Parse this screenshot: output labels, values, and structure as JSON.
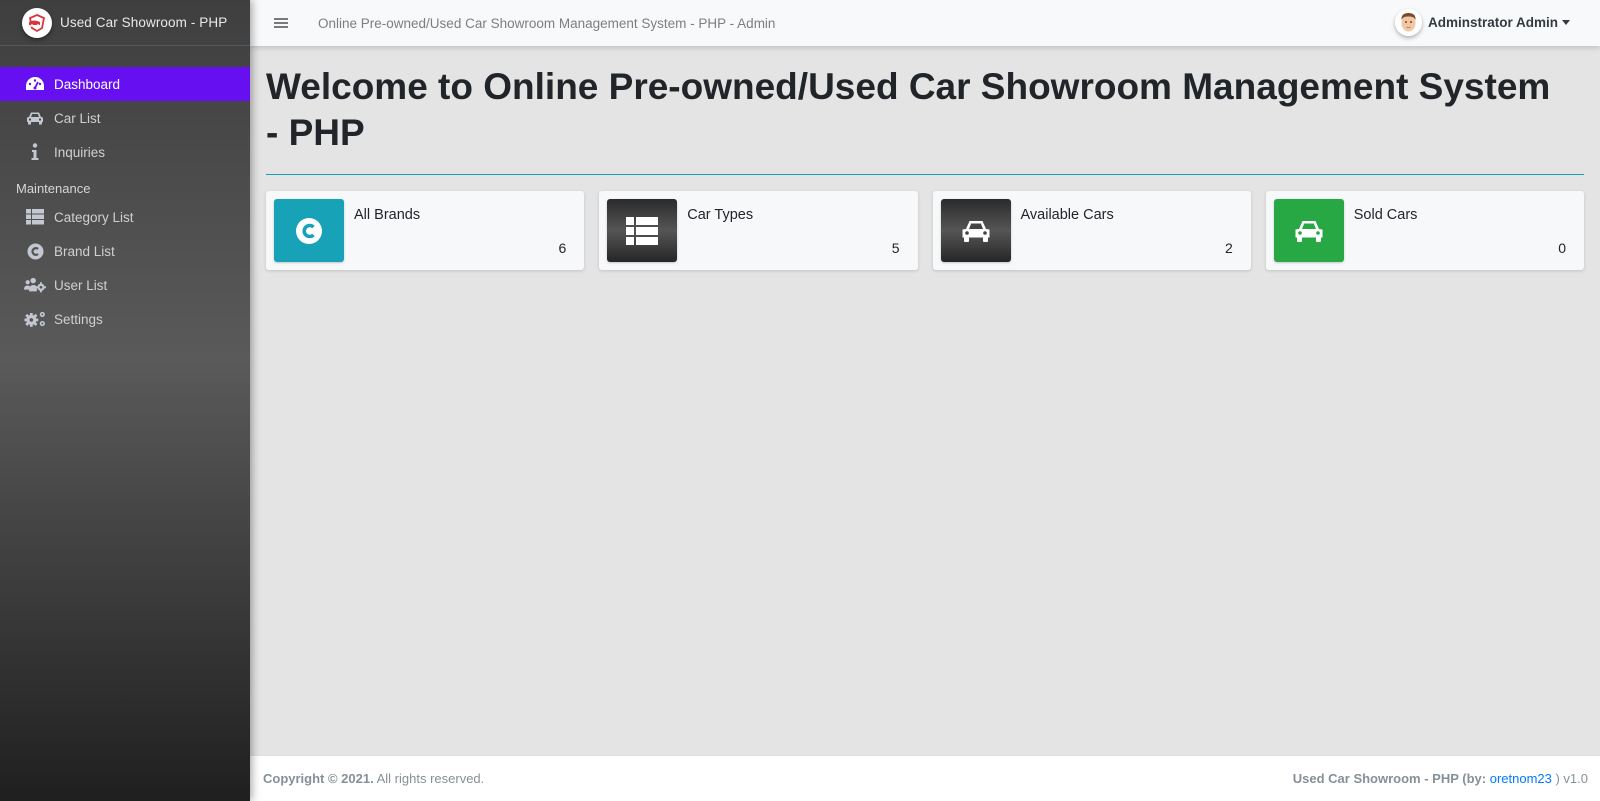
{
  "app": {
    "brand_name": "Used Car Showroom - PHP",
    "topbar_title": "Online Pre-owned/Used Car Showroom Management System - PHP - Admin",
    "user_name": "Adminstrator Admin"
  },
  "sidebar": {
    "items": [
      {
        "label": "Dashboard",
        "icon": "tachometer-icon",
        "active": true
      },
      {
        "label": "Car List",
        "icon": "car-icon"
      },
      {
        "label": "Inquiries",
        "icon": "info-icon"
      }
    ],
    "section_header": "Maintenance",
    "maintenance_items": [
      {
        "label": "Category List",
        "icon": "table-list-icon"
      },
      {
        "label": "Brand List",
        "icon": "copyright-icon"
      },
      {
        "label": "User List",
        "icon": "users-cog-icon"
      },
      {
        "label": "Settings",
        "icon": "cogs-icon"
      }
    ]
  },
  "main": {
    "title": "Welcome to Online Pre-owned/Used Car Showroom Management System - PHP",
    "cards": [
      {
        "label": "All Brands",
        "value": "6",
        "icon": "copyright-icon",
        "color": "#17a2b8"
      },
      {
        "label": "Car Types",
        "value": "5",
        "icon": "table-list-icon",
        "color": "#343a40"
      },
      {
        "label": "Available Cars",
        "value": "2",
        "icon": "car-icon",
        "color": "#343a40"
      },
      {
        "label": "Sold Cars",
        "value": "0",
        "icon": "car-icon",
        "color": "#28a745"
      }
    ]
  },
  "footer": {
    "copyright_bold": "Copyright © 2021.",
    "copyright_rest": " All rights reserved.",
    "credit_prefix": "Used Car Showroom - PHP (by: ",
    "credit_link": "oretnom23",
    "credit_suffix": " ) v1.0"
  },
  "colors": {
    "accent": "#6610f2",
    "info": "#17a2b8",
    "success": "#28a745",
    "link": "#007bff"
  }
}
